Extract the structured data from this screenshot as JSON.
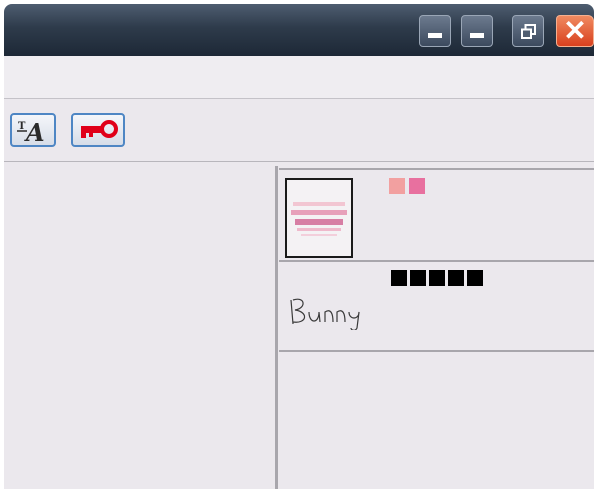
{
  "titlebar": {
    "buttons": [
      "minimize-icon",
      "minimize-icon",
      "restore-icon",
      "close-icon"
    ],
    "close_glyph": "✕"
  },
  "toolbar": {
    "buttons": [
      {
        "name": "font-style-icon",
        "color": "#2b2b2b"
      },
      {
        "name": "key-icon",
        "color": "#e0001a"
      }
    ]
  },
  "panel": {
    "items": [
      {
        "type": "image-thumbnail",
        "swatches": [
          "#f2a0a0",
          "#e8709f"
        ]
      },
      {
        "type": "signature",
        "text": "Bunny",
        "squares": 5
      }
    ]
  },
  "colors": {
    "titlebar": "#2e3b4b",
    "window_bg": "#ebe8ed",
    "accent_blue": "#4e86c4",
    "close_red": "#e04b25"
  }
}
